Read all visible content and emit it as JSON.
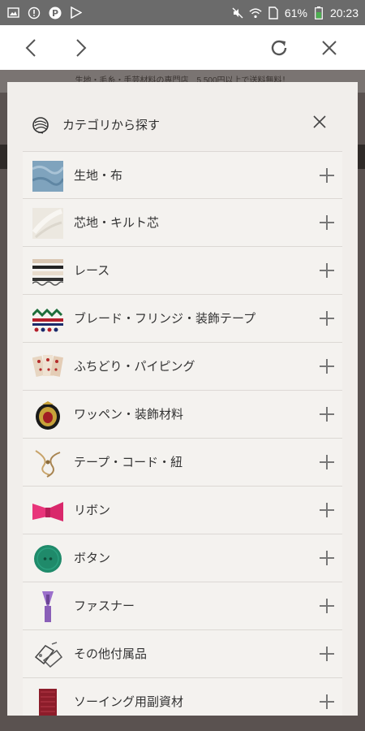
{
  "status_bar": {
    "battery": "61%",
    "time": "20:23",
    "icons": [
      "image-icon",
      "info-icon",
      "p-app-icon",
      "play-store-icon",
      "mute-icon",
      "wifi-icon",
      "sim-icon",
      "battery-icon"
    ]
  },
  "browser": {
    "back_icon": "chevron-left-icon",
    "forward_icon": "chevron-right-icon",
    "reload_icon": "reload-icon",
    "close_icon": "close-icon"
  },
  "background_page": {
    "banner_text": "生地・毛糸・手芸材料の専門店　5,500円以上で送料無料！"
  },
  "modal": {
    "title": "カテゴリから探す",
    "title_icon": "yarn-ball-icon",
    "close_icon": "close-icon",
    "categories": [
      {
        "label": "生地・布",
        "thumb": "fabric-thumb"
      },
      {
        "label": "芯地・キルト芯",
        "thumb": "interfacing-thumb"
      },
      {
        "label": "レース",
        "thumb": "lace-thumb"
      },
      {
        "label": "ブレード・フリンジ・装飾テープ",
        "thumb": "braid-thumb"
      },
      {
        "label": "ふちどり・パイピング",
        "thumb": "piping-thumb"
      },
      {
        "label": "ワッペン・装飾材料",
        "thumb": "patch-thumb"
      },
      {
        "label": "テープ・コード・紐",
        "thumb": "cord-thumb"
      },
      {
        "label": "リボン",
        "thumb": "ribbon-thumb"
      },
      {
        "label": "ボタン",
        "thumb": "button-thumb"
      },
      {
        "label": "ファスナー",
        "thumb": "zipper-thumb"
      },
      {
        "label": "その他付属品",
        "thumb": "accessories-thumb"
      },
      {
        "label": "ソーイング用副資材",
        "thumb": "sewing-supplies-thumb"
      }
    ]
  },
  "colors": {
    "modal_bg": "#f1eeeb",
    "overlay": "#5a5250",
    "status_bar": "#6b6b6b",
    "battery_green": "#4caf50",
    "ribbon_pink": "#e8357a",
    "button_green": "#1f8a6a",
    "zipper_purple": "#8a5fb8",
    "supplies_red": "#8c1d2a"
  }
}
